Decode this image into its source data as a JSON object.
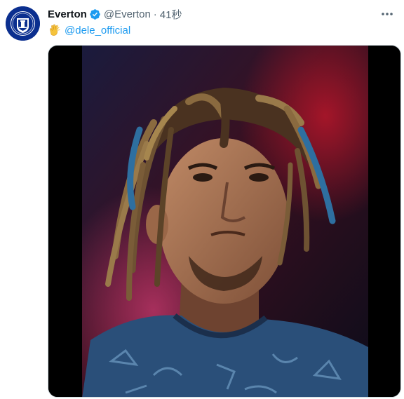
{
  "tweet": {
    "author": {
      "display_name": "Everton",
      "handle": "@Everton",
      "verified": true,
      "avatar_icon": "everton-crest-icon",
      "avatar_color": "#0b2f8f"
    },
    "separator": "·",
    "timestamp": "41秒",
    "text": {
      "emoji_icon": "clapping-hands-icon",
      "mention": "@dele_official"
    },
    "media": {
      "type": "video-frame",
      "subject": "portrait-icon"
    },
    "colors": {
      "name": "#0f1419",
      "secondary": "#536471",
      "link": "#1d9bf0",
      "verified": "#1d9bf0"
    }
  }
}
